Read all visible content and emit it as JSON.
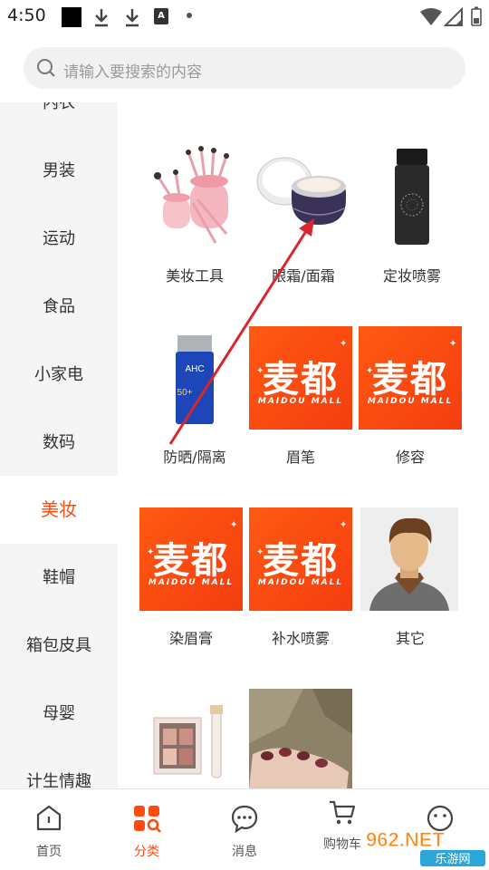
{
  "status_bar": {
    "time": "4:50",
    "badge_letter": "A"
  },
  "search": {
    "placeholder": "请输入要搜索的内容"
  },
  "sidebar": {
    "items": [
      {
        "label": "内衣"
      },
      {
        "label": "男装"
      },
      {
        "label": "运动"
      },
      {
        "label": "食品"
      },
      {
        "label": "小家电"
      },
      {
        "label": "数码"
      },
      {
        "label": "美妆"
      },
      {
        "label": "鞋帽"
      },
      {
        "label": "箱包皮具"
      },
      {
        "label": "母婴"
      },
      {
        "label": "计生情趣"
      }
    ],
    "active": "美妆"
  },
  "categories": [
    {
      "label": "美妆工具",
      "image": "makeup-brushes"
    },
    {
      "label": "眼霜/面霜",
      "image": "cream-jar"
    },
    {
      "label": "定妆喷雾",
      "image": "black-spray-bottle"
    },
    {
      "label": "防晒/隔离",
      "image": "sunscreen-bottle"
    },
    {
      "label": "眉笔",
      "image": "maidou-mall-placeholder"
    },
    {
      "label": "修容",
      "image": "maidou-mall-placeholder"
    },
    {
      "label": "染眉膏",
      "image": "maidou-mall-placeholder"
    },
    {
      "label": "补水喷雾",
      "image": "maidou-mall-placeholder"
    },
    {
      "label": "其它",
      "image": "man-avatar"
    },
    {
      "label": "",
      "image": "eyeshadow-palette"
    },
    {
      "label": "",
      "image": "nail-art-hand"
    }
  ],
  "placeholder_logo": {
    "title": "麦都",
    "subtitle": "MAIDOU MALL"
  },
  "tabs": [
    {
      "label": "首页",
      "icon": "home-icon"
    },
    {
      "label": "分类",
      "icon": "category-icon"
    },
    {
      "label": "消息",
      "icon": "message-icon"
    },
    {
      "label": "购物车",
      "icon": "cart-icon"
    },
    {
      "label": "",
      "icon": "profile-icon"
    }
  ],
  "watermark": {
    "brand": "962.NET",
    "text": "乐游网"
  },
  "colors": {
    "accent": "#ff4b12",
    "sidebar_bg": "#f5f5f5",
    "annotation_arrow": "#d8262d"
  }
}
